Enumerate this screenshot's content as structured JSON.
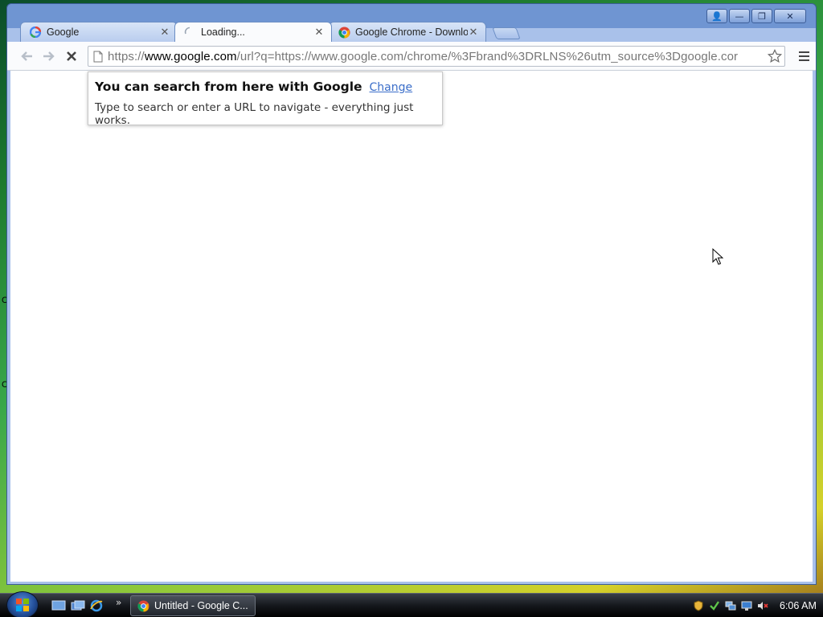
{
  "window": {
    "controls": [
      "👤",
      "—",
      "❐",
      "✕"
    ]
  },
  "tabs": [
    {
      "title": "Google",
      "icon": "google-g-icon",
      "active": false
    },
    {
      "title": "Loading...",
      "icon": "loading-spinner-icon",
      "active": true
    },
    {
      "title": "Google Chrome - Downlo",
      "icon": "chrome-icon",
      "active": false
    }
  ],
  "toolbar": {
    "url_prefix": "https://",
    "url_host": "www.google.com",
    "url_rest": "/url?q=https://www.google.com/chrome/%3Fbrand%3DRLNS%26utm_source%3Dgoogle.cor"
  },
  "bubble": {
    "title": "You can search from here with Google",
    "link": "Change",
    "subtitle": "Type to search or enter a URL to navigate - everything just works."
  },
  "taskbar": {
    "task_label": "Untitled - Google C...",
    "quicklaunch_more": "»",
    "clock": "6:06 AM"
  },
  "desktop": {
    "glyph_top": "C",
    "glyph_bottom": "C"
  },
  "colors": {
    "window_frame": "#6f95d2",
    "link": "#3b6ec9",
    "taskbar": "#15181d"
  }
}
